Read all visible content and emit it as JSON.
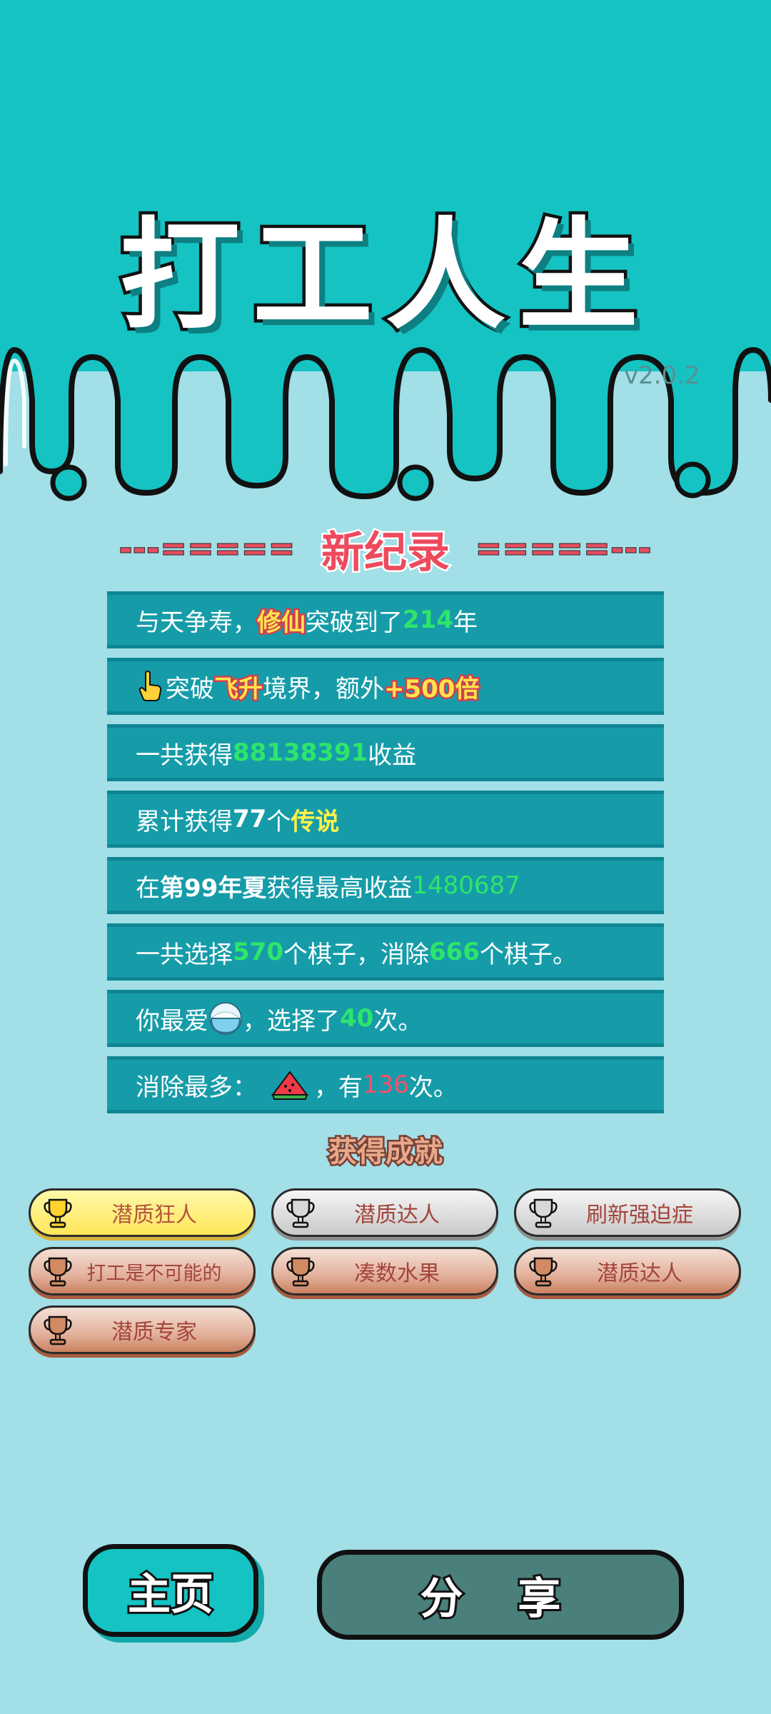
{
  "header": {
    "title": "打工人生",
    "version": "v2.0.2"
  },
  "record": {
    "left_dashes": "---=====",
    "title": "新纪录",
    "right_dashes": "=====---"
  },
  "stats": {
    "r1": {
      "pre": "与天争寿，",
      "hl": "修仙",
      "mid": "突破到了",
      "num": "214",
      "post": "年"
    },
    "r2": {
      "icon": "pointing-hand-icon",
      "pre": "突破 ",
      "hl": "飞升",
      "mid": " 境界，额外 ",
      "num": "+500倍"
    },
    "r3": {
      "pre": "一共获得",
      "num": "88138391",
      "post": "收益"
    },
    "r4": {
      "pre": "累计获得",
      "num": "77",
      "mid": "个 ",
      "hl": "传说"
    },
    "r5": {
      "pre": "在 ",
      "hl": "第99年夏",
      "mid": " 获得最高收益",
      "num": "1480687"
    },
    "r6": {
      "pre": "一共选择",
      "num1": "570",
      "mid": "个棋子，消除",
      "num2": "666",
      "post": "个棋子。"
    },
    "r7": {
      "pre": "你最爱",
      "icon": "rice-bowl-icon",
      "mid": "，选择了",
      "num": "40",
      "post": "次。"
    },
    "r8": {
      "pre": "消除最多：",
      "icon": "watermelon-icon",
      "mid": "，有",
      "num": "136",
      "post": "次。"
    }
  },
  "achievements": {
    "title": "获得成就",
    "items": [
      {
        "label": "潜质狂人",
        "tier": "gold"
      },
      {
        "label": "潜质达人",
        "tier": "silver"
      },
      {
        "label": "刷新强迫症",
        "tier": "silver"
      },
      {
        "label": "打工是不可能的",
        "tier": "bronze"
      },
      {
        "label": "凑数水果",
        "tier": "bronze"
      },
      {
        "label": "潜质达人",
        "tier": "bronze"
      },
      {
        "label": "潜质专家",
        "tier": "bronze"
      }
    ]
  },
  "buttons": {
    "home": "主页",
    "share": "分 享"
  },
  "colors": {
    "teal": "#15c3c3",
    "light_teal": "#a2dfe7",
    "row": "#169ca9",
    "green": "#2ee56a",
    "red": "#ff4d6a",
    "gold": "#ffe44a"
  }
}
